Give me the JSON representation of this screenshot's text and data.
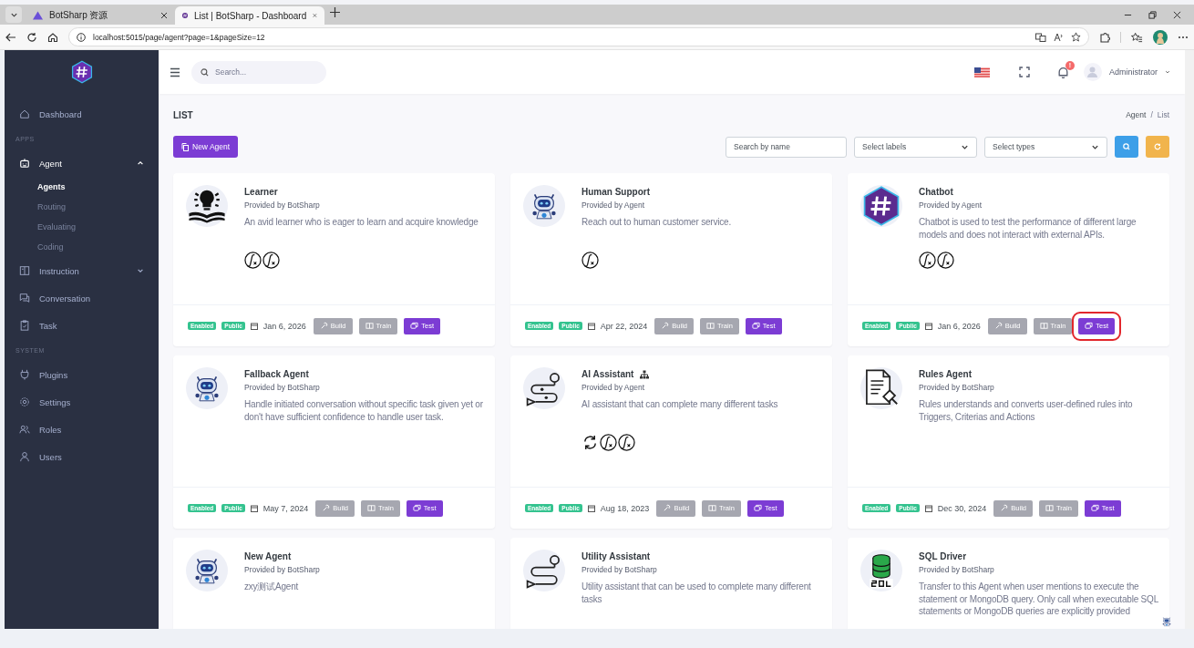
{
  "browser": {
    "tabs": [
      {
        "title": "BotSharp 资源",
        "selected": false
      },
      {
        "title": "List | BotSharp - Dashboard",
        "selected": true
      }
    ],
    "address": "localhost:5015/page/agent?page=1&pageSize=12"
  },
  "sidebar": {
    "items": [
      {
        "kind": "link",
        "label": "Dashboard",
        "selected": false
      },
      {
        "kind": "header",
        "label": "APPS"
      },
      {
        "kind": "group",
        "label": "Agent",
        "selected": true,
        "expanded": true,
        "children": [
          {
            "label": "Agents",
            "selected": true
          },
          {
            "label": "Routing",
            "selected": false
          },
          {
            "label": "Evaluating",
            "selected": false
          },
          {
            "label": "Coding",
            "selected": false
          }
        ]
      },
      {
        "kind": "group",
        "label": "Instruction",
        "selected": false,
        "expanded": false
      },
      {
        "kind": "link",
        "label": "Conversation",
        "selected": false
      },
      {
        "kind": "link",
        "label": "Task",
        "selected": false
      },
      {
        "kind": "header",
        "label": "SYSTEM"
      },
      {
        "kind": "link",
        "label": "Plugins",
        "selected": false
      },
      {
        "kind": "link",
        "label": "Settings",
        "selected": false
      },
      {
        "kind": "link",
        "label": "Roles",
        "selected": false
      },
      {
        "kind": "link",
        "label": "Users",
        "selected": false
      }
    ]
  },
  "header": {
    "search": {
      "placeholder": "Search..."
    },
    "notification_badge": "!",
    "user": "Administrator"
  },
  "page": {
    "title": "LIST",
    "breadcrumb": [
      "Agent",
      "List"
    ],
    "breadcrumb_separator": "/"
  },
  "toolbar": {
    "new_button": "New Agent",
    "name_search": {
      "placeholder": "Search by name"
    },
    "labels_select": "Select labels",
    "types_select": "Select types"
  },
  "agents": [
    {
      "name": "Learner",
      "provider": "Provided by BotSharp",
      "description": "An avid learner who is eager to learn and acquire knowledge",
      "routing": false,
      "tools": [
        {
          "kind": "function"
        },
        {
          "kind": "function"
        }
      ],
      "badges": [
        "Enabled",
        "Public"
      ],
      "date": "Jan 6, 2026",
      "actions": [
        {
          "label": "Build",
          "kind": "build",
          "highlighted": false
        },
        {
          "label": "Train",
          "kind": "train",
          "highlighted": false
        },
        {
          "label": "Test",
          "kind": "test",
          "highlighted": false
        }
      ]
    },
    {
      "name": "Human Support",
      "provider": "Provided by Agent",
      "description": "Reach out to human customer service.",
      "routing": false,
      "tools": [
        {
          "kind": "function"
        }
      ],
      "badges": [
        "Enabled",
        "Public"
      ],
      "date": "Apr 22, 2024",
      "actions": [
        {
          "label": "Build",
          "kind": "build",
          "highlighted": false
        },
        {
          "label": "Train",
          "kind": "train",
          "highlighted": false
        },
        {
          "label": "Test",
          "kind": "test",
          "highlighted": false
        }
      ]
    },
    {
      "name": "Chatbot",
      "provider": "Provided by Agent",
      "description": "Chatbot is used to test the performance of different large models and does not interact with external APIs.",
      "routing": false,
      "tools": [
        {
          "kind": "function"
        },
        {
          "kind": "function"
        }
      ],
      "badges": [
        "Enabled",
        "Public"
      ],
      "date": "Jan 6, 2026",
      "actions": [
        {
          "label": "Build",
          "kind": "build",
          "highlighted": false
        },
        {
          "label": "Train",
          "kind": "train",
          "highlighted": false
        },
        {
          "label": "Test",
          "kind": "test",
          "highlighted": true
        }
      ]
    },
    {
      "name": "Fallback Agent",
      "provider": "Provided by BotSharp",
      "description": "Handle initiated conversation without specific task given yet or don't have sufficient confidence to handle user task.",
      "routing": false,
      "badges": [
        "Enabled",
        "Public"
      ],
      "date": "May 7, 2024",
      "actions": [
        {
          "label": "Build",
          "kind": "build",
          "highlighted": false
        },
        {
          "label": "Train",
          "kind": "train",
          "highlighted": false
        },
        {
          "label": "Test",
          "kind": "test",
          "highlighted": false
        }
      ]
    },
    {
      "name": "AI Assistant",
      "provider": "Provided by Agent",
      "description": "AI assistant that can complete many different tasks",
      "routing": true,
      "tools": [
        {
          "kind": "sync"
        },
        {
          "kind": "function"
        },
        {
          "kind": "function"
        }
      ],
      "badges": [
        "Enabled",
        "Public"
      ],
      "date": "Aug 18, 2023",
      "actions": [
        {
          "label": "Build",
          "kind": "build",
          "highlighted": false
        },
        {
          "label": "Train",
          "kind": "train",
          "highlighted": false
        },
        {
          "label": "Test",
          "kind": "test",
          "highlighted": false
        }
      ]
    },
    {
      "name": "Rules Agent",
      "provider": "Provided by BotSharp",
      "description": "Rules understands and converts user-defined rules into Triggers, Criterias and Actions",
      "routing": false,
      "badges": [
        "Enabled",
        "Public"
      ],
      "date": "Dec 30, 2024",
      "actions": [
        {
          "label": "Build",
          "kind": "build",
          "highlighted": false
        },
        {
          "label": "Train",
          "kind": "train",
          "highlighted": false
        },
        {
          "label": "Test",
          "kind": "test",
          "highlighted": false
        }
      ]
    },
    {
      "name": "New Agent",
      "provider": "Provided by BotSharp",
      "description": "zxy测试Agent",
      "routing": false
    },
    {
      "name": "Utility Assistant",
      "provider": "Provided by BotSharp",
      "description": "Utility assistant that can be used to complete many different tasks",
      "routing": false
    },
    {
      "name": "SQL Driver",
      "provider": "Provided by BotSharp",
      "description": "Transfer to this Agent when user mentions to execute the statement or MongoDB query. Only call when executable SQL statements or MongoDB queries are explicitly provided",
      "routing": false
    }
  ]
}
